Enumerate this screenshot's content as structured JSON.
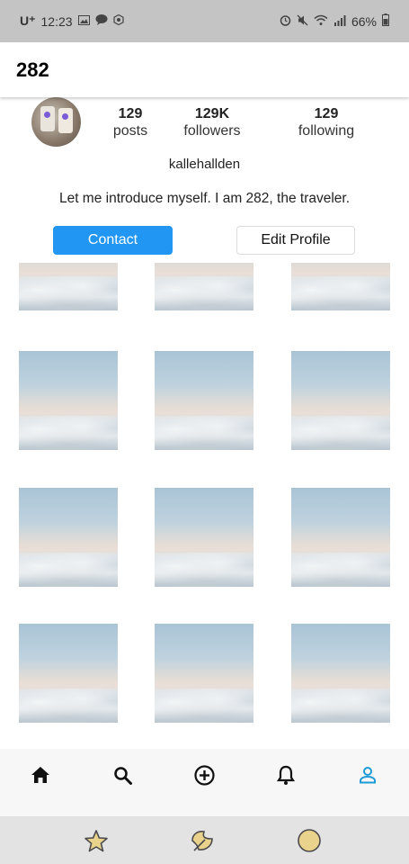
{
  "status_bar": {
    "carrier": "U⁺",
    "time": "12:23",
    "battery": "66%"
  },
  "app_bar": {
    "title": "282"
  },
  "profile": {
    "stats": [
      {
        "value": "129",
        "label": "posts"
      },
      {
        "value": "129K",
        "label": "followers"
      },
      {
        "value": "129",
        "label": "following"
      }
    ],
    "username": "kallehallden",
    "bio": "Let me introduce myself. I am 282, the traveler.",
    "contact_label": "Contact",
    "edit_label": "Edit Profile"
  },
  "grid": {
    "tiles": 12
  },
  "bottom_nav": {
    "items": [
      "home-icon",
      "search-icon",
      "add-circle-icon",
      "notification-bell-icon",
      "profile-icon"
    ],
    "active": "profile-icon",
    "active_color": "#1e9bd7"
  },
  "system_bar": {
    "items": [
      "star-icon",
      "leaf-icon",
      "circle-icon"
    ]
  },
  "colors": {
    "accent": "#2196f3",
    "status_bar": "#c4c4c4",
    "system_bar": "#e3e3e3"
  }
}
